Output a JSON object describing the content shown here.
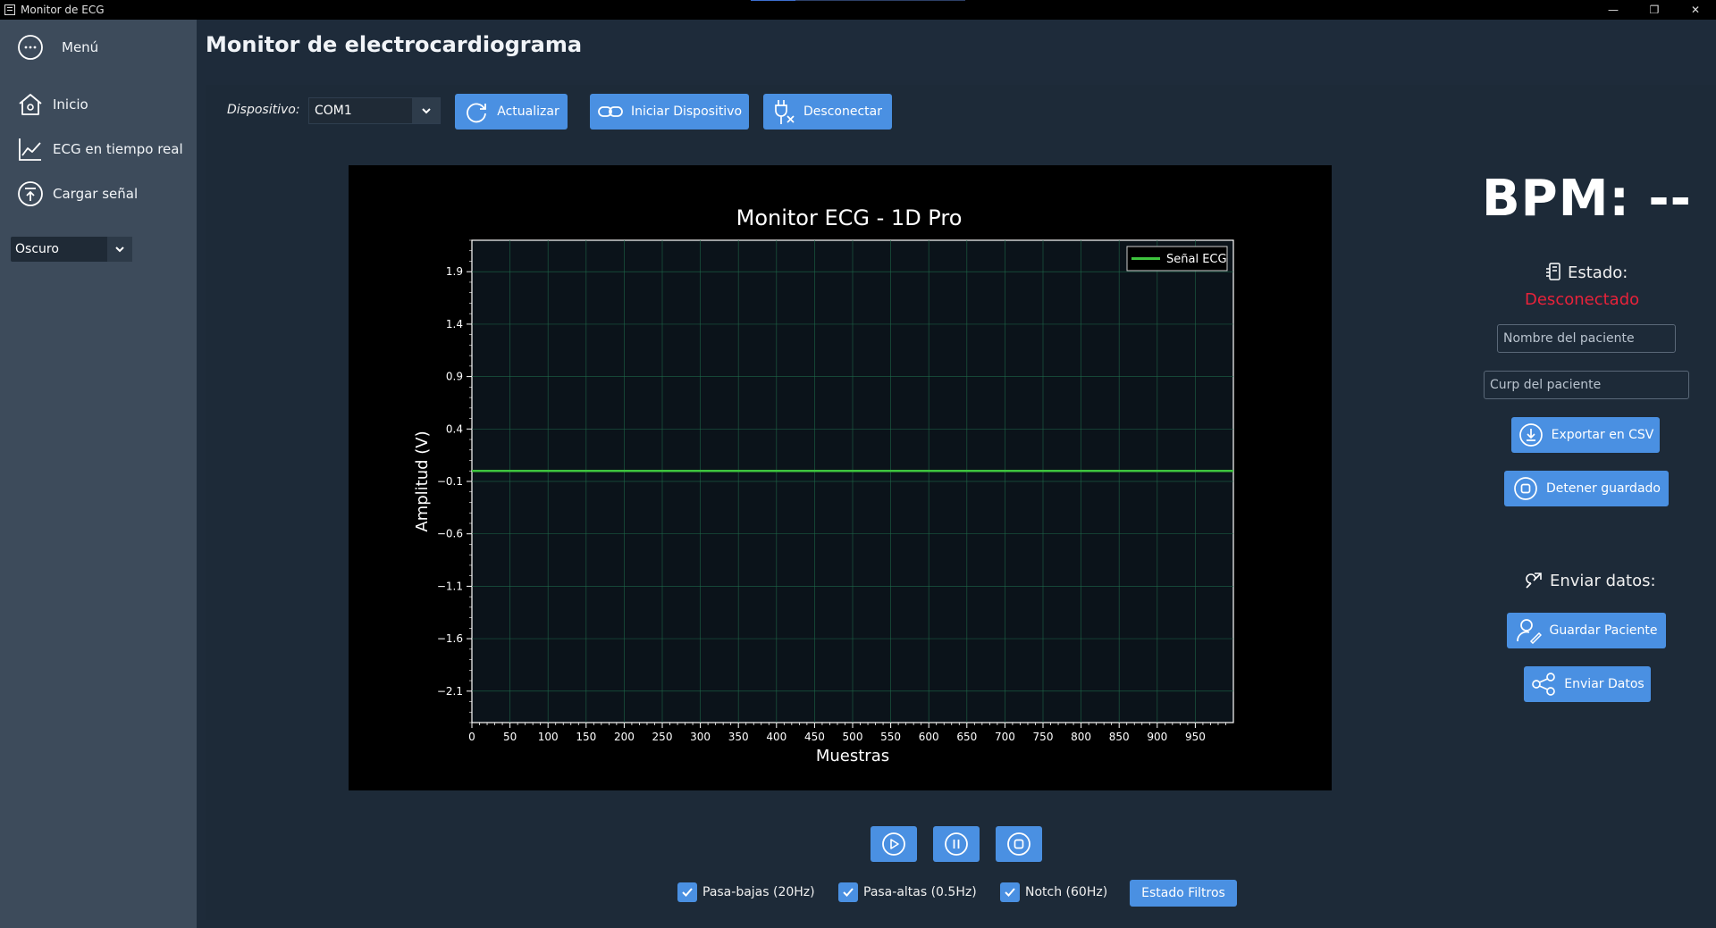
{
  "window": {
    "title": "Monitor de ECG",
    "controls": [
      "minimize-icon",
      "restore-icon",
      "close-icon"
    ]
  },
  "sidebar": {
    "menu_label": "Menú",
    "items": [
      {
        "label": "Inicio",
        "icon": "home-icon"
      },
      {
        "label": "ECG en tiempo real",
        "icon": "line-chart-icon"
      },
      {
        "label": "Cargar señal",
        "icon": "upload-icon"
      }
    ],
    "theme": {
      "selected": "Oscuro"
    }
  },
  "header": {
    "title": "Monitor de electrocardiograma"
  },
  "toolbar": {
    "device_label": "Dispositivo:",
    "device_selected": "COM1",
    "refresh_label": "Actualizar",
    "start_label": "Iniciar Dispositivo",
    "disconnect_label": "Desconectar"
  },
  "chart_data": {
    "type": "line",
    "title": "Monitor ECG - 1D Pro",
    "xlabel": "Muestras",
    "ylabel": "Amplitud (V)",
    "xlim": [
      0,
      1000
    ],
    "ylim": [
      -2.4,
      2.2
    ],
    "xticks": [
      0,
      50,
      100,
      150,
      200,
      250,
      300,
      350,
      400,
      450,
      500,
      550,
      600,
      650,
      700,
      750,
      800,
      850,
      900,
      950
    ],
    "yticks": [
      1.9,
      1.4,
      0.9,
      0.4,
      -0.1,
      -0.6,
      -1.1,
      -1.6,
      -2.1
    ],
    "ytick_labels": [
      "1.9",
      "1.4",
      "0.9",
      "0.4",
      "−0.1",
      "−0.6",
      "−1.1",
      "−1.6",
      "−2.1"
    ],
    "grid": true,
    "legend": "top-right",
    "series": [
      {
        "name": "Señal ECG",
        "color": "#3ec43e",
        "x": [
          0,
          1000
        ],
        "y": [
          0,
          0
        ]
      }
    ]
  },
  "status": {
    "bpm_text": "BPM: --",
    "estado_label": "Estado:",
    "estado_value": "Desconectado",
    "estado_color": "#e8223a",
    "patient_name_placeholder": "Nombre del paciente",
    "patient_curp_placeholder": "Curp del paciente",
    "export_label": "Exportar en CSV",
    "stop_save_label": "Detener guardado",
    "send_section_label": "Enviar datos:",
    "save_patient_label": "Guardar Paciente",
    "send_data_label": "Enviar Datos"
  },
  "playback": {
    "icons": [
      "play-icon",
      "pause-icon",
      "stop-icon"
    ]
  },
  "filters": {
    "items": [
      {
        "label": "Pasa-bajas (20Hz)",
        "checked": true
      },
      {
        "label": "Pasa-altas (0.5Hz)",
        "checked": true
      },
      {
        "label": "Notch (60Hz)",
        "checked": true
      }
    ],
    "status_label": "Estado Filtros"
  },
  "colors": {
    "accent": "#4a90e2",
    "sidebar": "#3d4b5b",
    "background": "#1e2b3a"
  }
}
